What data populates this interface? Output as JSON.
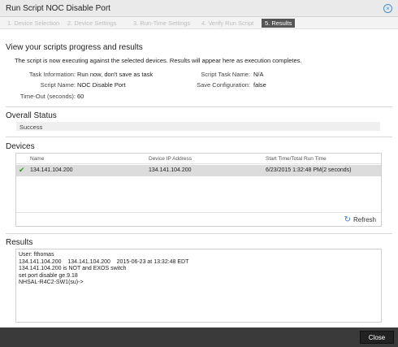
{
  "window": {
    "title": "Run Script NOC Disable Port"
  },
  "wizard": {
    "steps": [
      "1. Device Selection",
      "2. Device Settings",
      "3. Run-Time Settings",
      "4. Verify Run Script",
      "5. Results"
    ],
    "active_index": 4
  },
  "progress": {
    "heading": "View your scripts progress and results",
    "description": "The script is now executing against the selected devices. Results will appear here as execution completes.",
    "task_information_label": "Task Information:",
    "task_information_value": "Run now, don't save as task",
    "script_name_label": "Script Name:",
    "script_name_value": "NOC Disable Port",
    "timeout_label": "Time-Out (seconds):",
    "timeout_value": "60",
    "script_task_name_label": "Script Task Name:",
    "script_task_name_value": "N/A",
    "save_configuration_label": "Save Configuration:",
    "save_configuration_value": "false"
  },
  "overall_status": {
    "heading": "Overall Status",
    "value": "Success"
  },
  "devices": {
    "heading": "Devices",
    "columns": [
      "Name",
      "Device IP Address",
      "Start Time/Total Run Time"
    ],
    "rows": [
      {
        "name": "134.141.104.200",
        "ip": "134.141.104.200",
        "time": "6/23/2015 1:32:48 PM(2 seconds)",
        "status_icon": "checkmark-icon"
      }
    ],
    "refresh_label": "Refresh"
  },
  "results": {
    "heading": "Results",
    "lines": [
      "User: fthomas",
      "134.141.104.200    134.141.104.200    2015-06-23 at 13:32:48 EDT",
      "134.141.104.200 is NOT and EXOS switch",
      "set port disable ge.9.18",
      "NHSAL-R4C2-SW1(su)->"
    ]
  },
  "footer": {
    "close_label": "Close"
  },
  "colors": {
    "accent": "#4a8cc8",
    "success": "#3a9a2a",
    "active_step": "#555555"
  }
}
